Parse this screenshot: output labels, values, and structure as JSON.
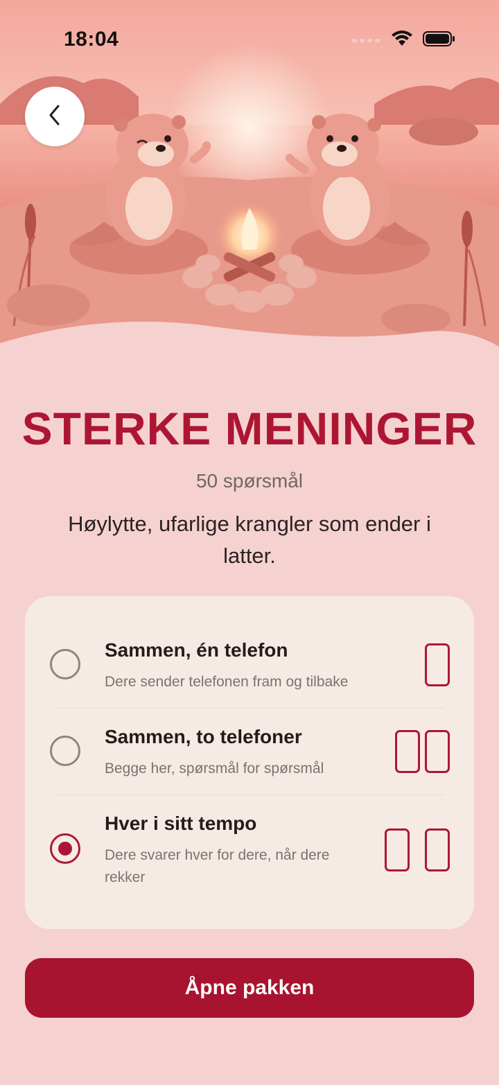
{
  "status_bar": {
    "time": "18:04"
  },
  "pack": {
    "title": "STERKE MENINGER",
    "count": "50 spørsmål",
    "description": "Høylytte, ufarlige krangler som ender i latter."
  },
  "modes": [
    {
      "title": "Sammen, én telefon",
      "subtitle": "Dere sender telefonen fram og tilbake",
      "selected": false
    },
    {
      "title": "Sammen, to telefoner",
      "subtitle": "Begge her, spørsmål for spørsmål",
      "selected": false
    },
    {
      "title": "Hver i sitt tempo",
      "subtitle": "Dere svarer hver for dere, når dere rekker",
      "selected": true
    }
  ],
  "cta_label": "Åpne pakken",
  "colors": {
    "accent": "#ad1633",
    "background": "#f5d2d0",
    "card": "#f6ebe4"
  }
}
